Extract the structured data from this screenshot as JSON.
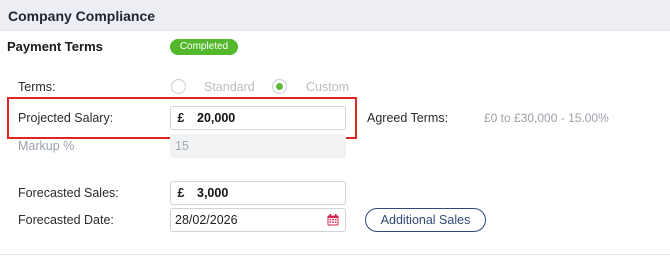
{
  "header": {
    "title": "Company Compliance"
  },
  "payment_terms": {
    "title": "Payment Terms",
    "status_badge": "Completed",
    "terms_label": "Terms:",
    "options": [
      {
        "label": "Standard",
        "checked": false
      },
      {
        "label": "Custom",
        "checked": true
      }
    ],
    "projected_salary": {
      "label": "Projected Salary:",
      "currency": "£",
      "value": "20,000"
    },
    "agreed_terms": {
      "label": "Agreed Terms:",
      "value": "£0 to £30,000 - 15.00%"
    },
    "markup": {
      "label": "Markup %",
      "value": "15"
    },
    "forecasted_sales": {
      "label": "Forecasted Sales:",
      "currency": "£",
      "value": "3,000"
    },
    "forecasted_date": {
      "label": "Forecasted Date:",
      "value": "28/02/2026",
      "icon": "calendar-icon"
    },
    "additional_sales_button": "Additional Sales"
  },
  "colors": {
    "badge": "#53b82c",
    "radio_checked": "#5cbc35",
    "highlight": "#e02323",
    "button": "#2e4a78",
    "calendar_icon": "#d0244a"
  }
}
